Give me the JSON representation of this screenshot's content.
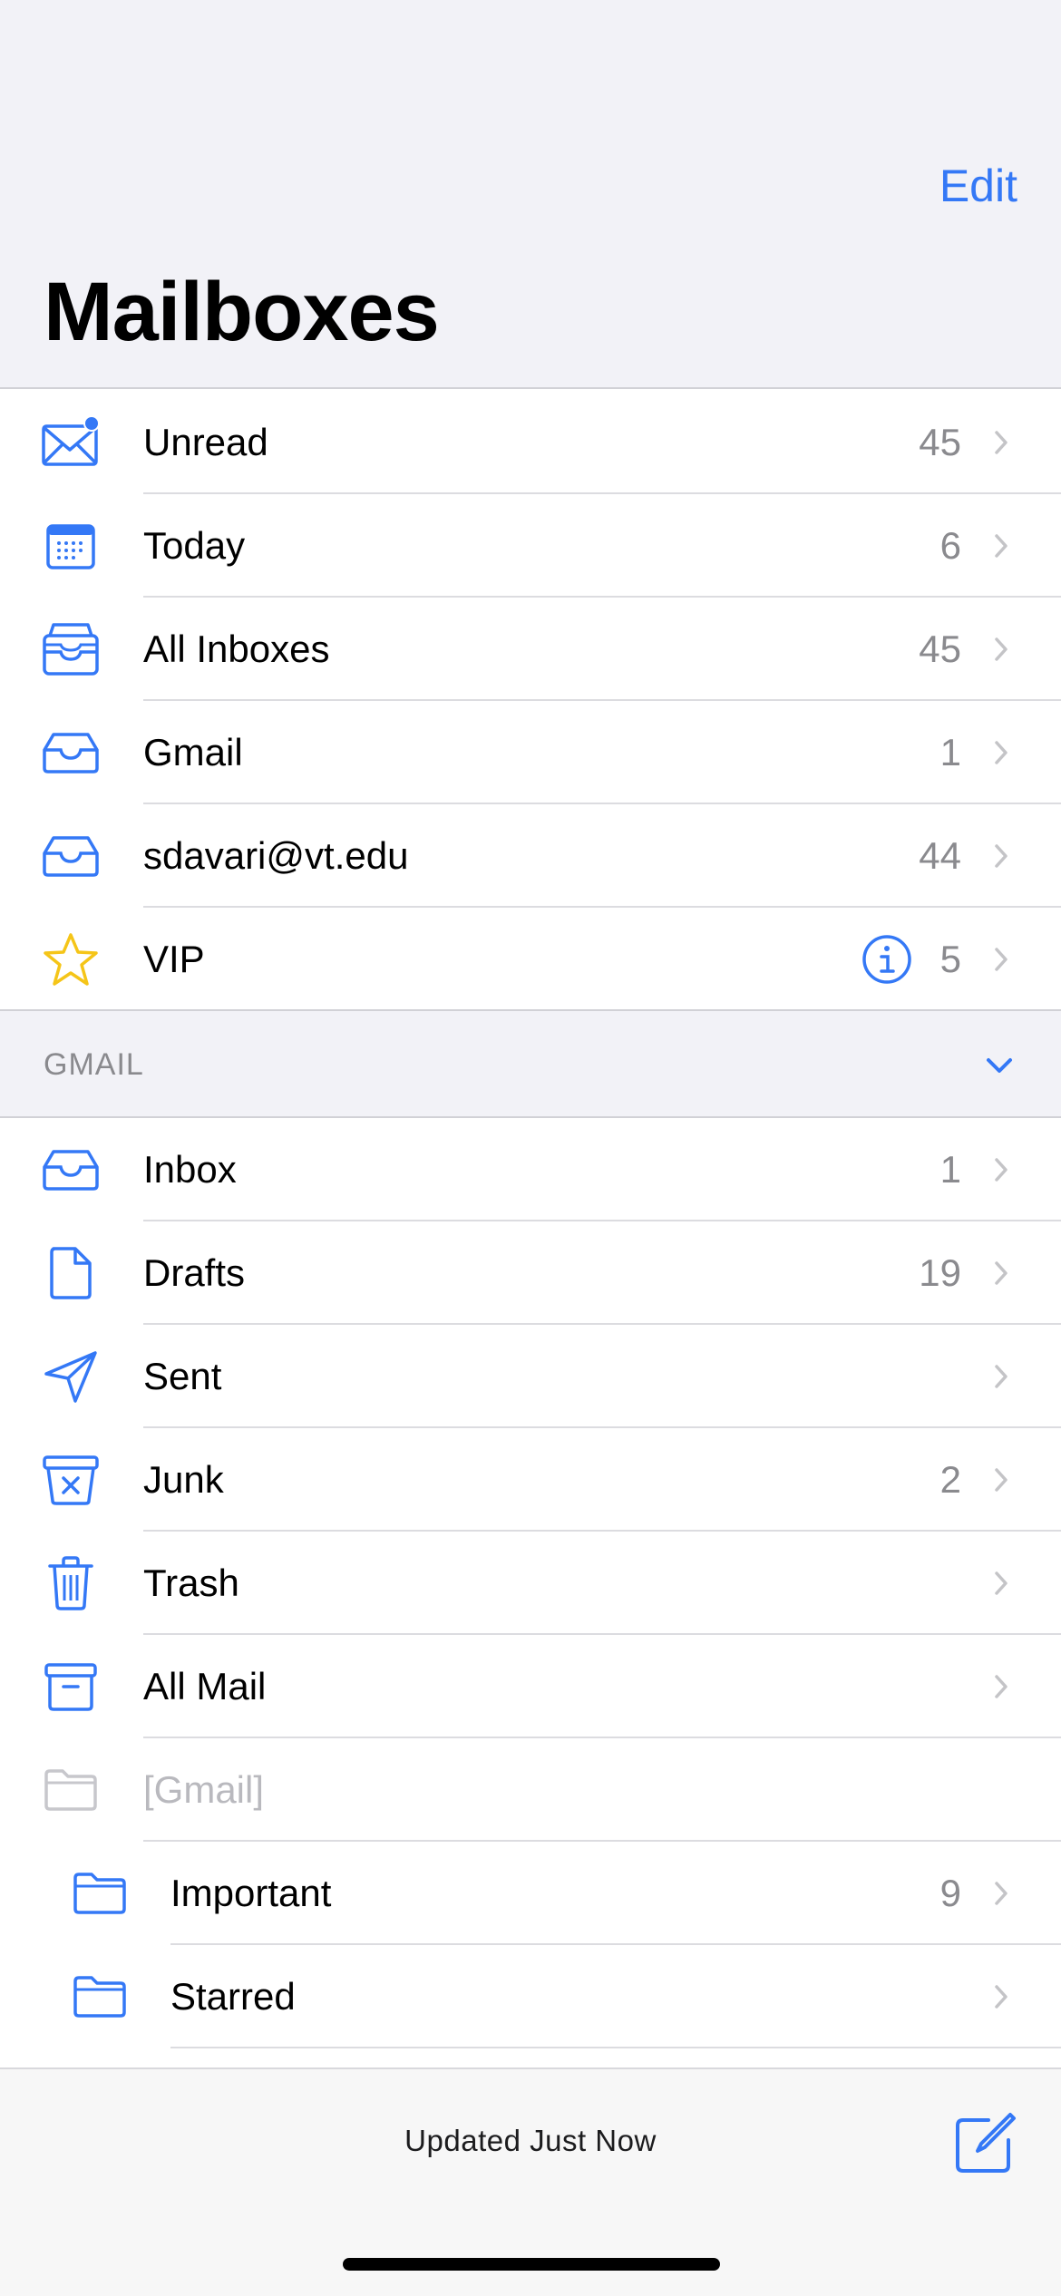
{
  "header": {
    "title": "Mailboxes",
    "edit_label": "Edit"
  },
  "colors": {
    "accent": "#3478f6",
    "vip_star": "#f5c518",
    "count_gray": "#8a8a8e",
    "disabled_gray": "#b9b9be"
  },
  "mailboxes": [
    {
      "label": "Unread",
      "count": "45",
      "icon": "envelope-unread-icon"
    },
    {
      "label": "Today",
      "count": "6",
      "icon": "calendar-icon"
    },
    {
      "label": "All Inboxes",
      "count": "45",
      "icon": "all-inboxes-icon"
    },
    {
      "label": "Gmail",
      "count": "1",
      "icon": "inbox-tray-icon"
    },
    {
      "label": "sdavari@vt.edu",
      "count": "44",
      "icon": "inbox-tray-icon"
    },
    {
      "label": "VIP",
      "count": "5",
      "icon": "star-icon"
    }
  ],
  "gmail_section": {
    "header": "GMAIL",
    "items": [
      {
        "label": "Inbox",
        "count": "1",
        "icon": "inbox-tray-icon"
      },
      {
        "label": "Drafts",
        "count": "19",
        "icon": "document-icon"
      },
      {
        "label": "Sent",
        "count": "",
        "icon": "paper-plane-icon"
      },
      {
        "label": "Junk",
        "count": "2",
        "icon": "junk-box-icon"
      },
      {
        "label": "Trash",
        "count": "",
        "icon": "trash-icon"
      },
      {
        "label": "All Mail",
        "count": "",
        "icon": "archive-box-icon"
      },
      {
        "label": "[Gmail]",
        "count": "",
        "icon": "folder-icon"
      },
      {
        "label": "Important",
        "count": "9",
        "icon": "folder-icon"
      },
      {
        "label": "Starred",
        "count": "",
        "icon": "folder-icon"
      }
    ]
  },
  "footer": {
    "status": "Updated Just Now"
  }
}
